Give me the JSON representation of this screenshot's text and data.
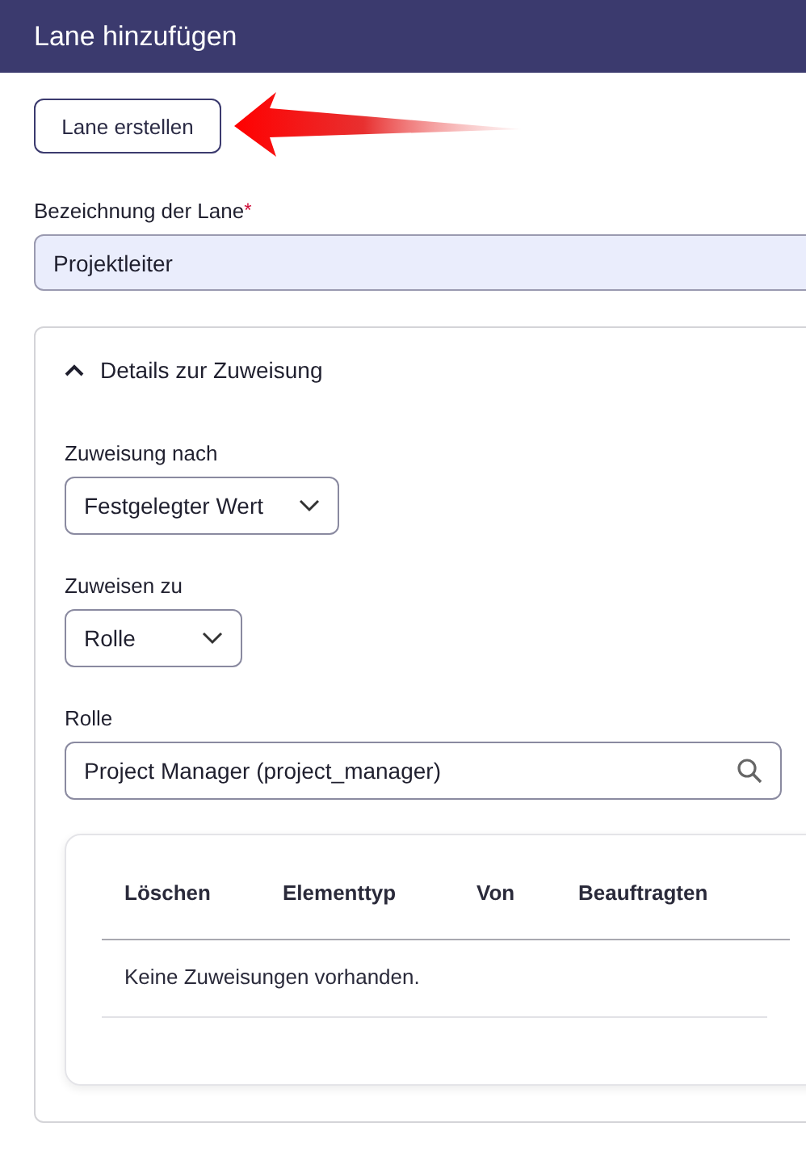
{
  "window": {
    "title": "Lane hinzufügen"
  },
  "create_button": {
    "label": "Lane erstellen"
  },
  "annotation": {
    "kind": "arrow"
  },
  "lane_name": {
    "label": "Bezeichnung der Lane",
    "required_mark": "*",
    "value": "Projektleiter"
  },
  "details": {
    "title": "Details zur Zuweisung",
    "expanded": true,
    "fields": [
      {
        "kind": "select",
        "label": "Zuweisung nach",
        "value": "Festgelegter Wert"
      },
      {
        "kind": "select",
        "label": "Zuweisen zu",
        "value": "Rolle"
      },
      {
        "kind": "search",
        "label": "Rolle",
        "value": "Project Manager (project_manager)"
      }
    ],
    "table": {
      "columns": [
        "Löschen",
        "Elementtyp",
        "Von",
        "Beauftragten"
      ],
      "empty_text": "Keine Zuweisungen vorhanden."
    }
  }
}
